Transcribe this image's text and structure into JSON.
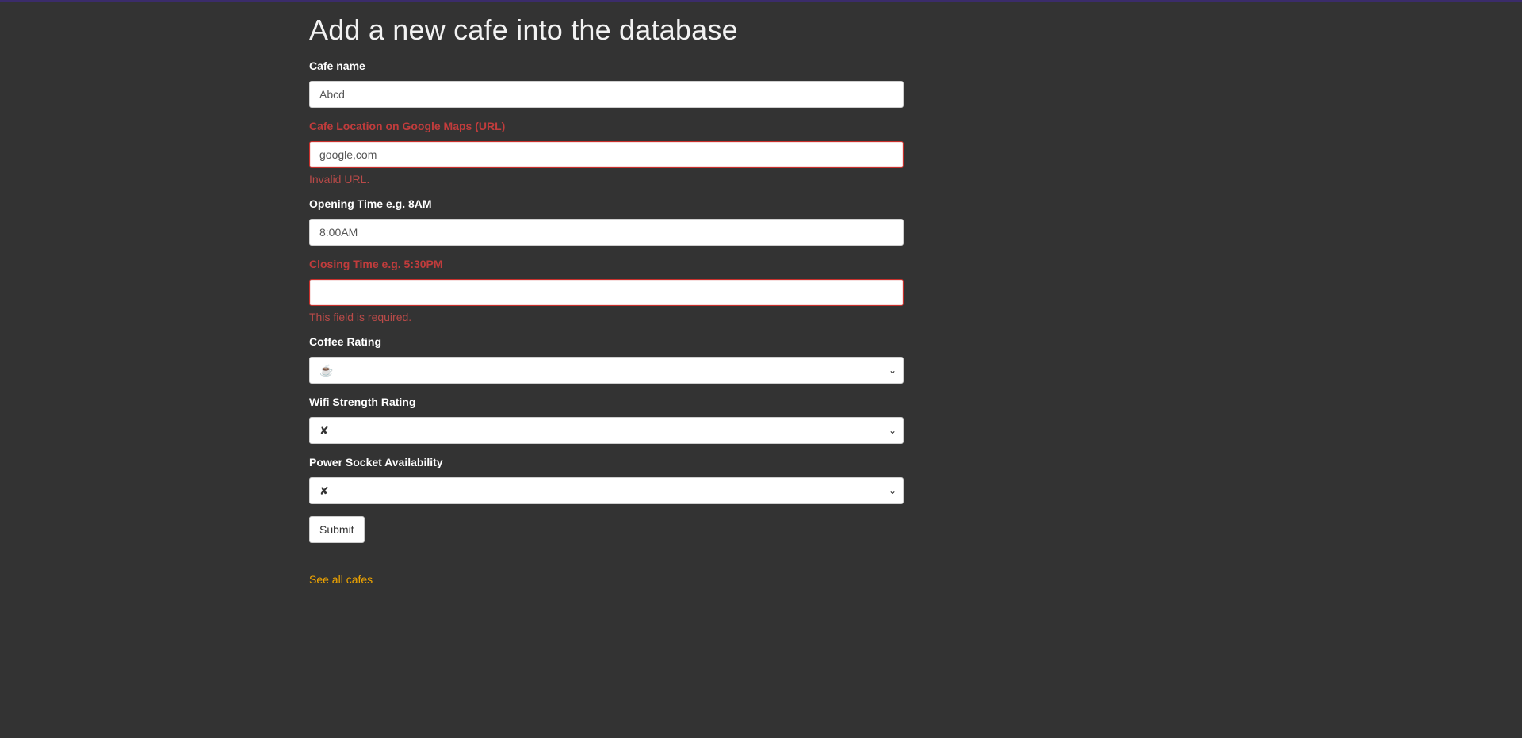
{
  "page": {
    "title": "Add a new cafe into the database"
  },
  "form": {
    "cafe_name": {
      "label": "Cafe name",
      "value": "Abcd"
    },
    "location": {
      "label": "Cafe Location on Google Maps (URL)",
      "value": "google,com",
      "error": "Invalid URL."
    },
    "open": {
      "label": "Opening Time e.g. 8AM",
      "value": "8:00AM"
    },
    "close": {
      "label": "Closing Time e.g. 5:30PM",
      "value": "",
      "error": "This field is required."
    },
    "coffee": {
      "label": "Coffee Rating",
      "selected": "☕️"
    },
    "wifi": {
      "label": "Wifi Strength Rating",
      "selected": "✘"
    },
    "power": {
      "label": "Power Socket Availability",
      "selected": "✘"
    },
    "submit_label": "Submit"
  },
  "links": {
    "see_all": "See all cafes"
  },
  "colors": {
    "background": "#333333",
    "error": "#c13c3c",
    "link": "#f0a500"
  }
}
